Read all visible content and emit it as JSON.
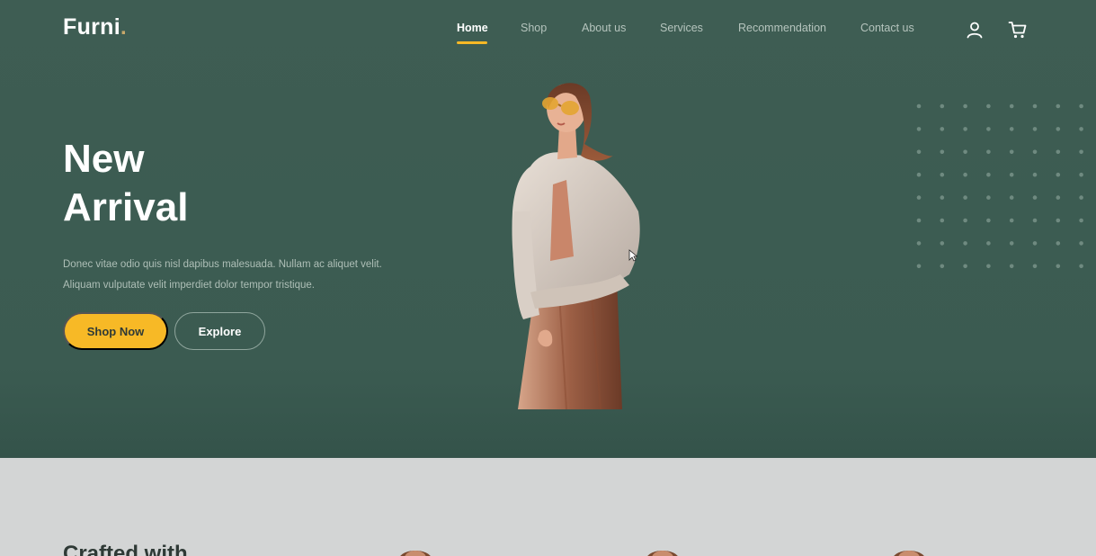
{
  "brand": {
    "name": "Furni",
    "dot": "."
  },
  "nav": {
    "items": [
      {
        "label": "Home",
        "active": true
      },
      {
        "label": "Shop",
        "active": false
      },
      {
        "label": "About us",
        "active": false
      },
      {
        "label": "Services",
        "active": false
      },
      {
        "label": "Recommendation",
        "active": false
      },
      {
        "label": "Contact us",
        "active": false
      }
    ],
    "icons": [
      "user-icon",
      "cart-icon"
    ]
  },
  "hero": {
    "title_line1": "New",
    "title_line2": "Arrival",
    "description": "Donec vitae odio quis nisl dapibus malesuada. Nullam ac aliquet velit. Aliquam vulputate velit imperdiet dolor tempor tristique.",
    "primary_button": "Shop Now",
    "secondary_button": "Explore",
    "image": "woman-fashion-model-photo"
  },
  "next_section": {
    "title": "Crafted with"
  },
  "colors": {
    "hero_bg": "#3b5b51",
    "accent": "#f7b926",
    "text_light": "#ffffff",
    "text_muted": "#aebfb7",
    "lower_bg": "#d3d5d5"
  }
}
